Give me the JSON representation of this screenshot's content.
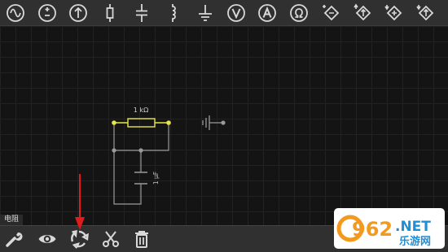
{
  "toolbar": {
    "items": [
      {
        "name": "ac-source-icon"
      },
      {
        "name": "dc-source-icon"
      },
      {
        "name": "current-source-icon"
      },
      {
        "name": "resistor-icon"
      },
      {
        "name": "capacitor-icon"
      },
      {
        "name": "inductor-icon"
      },
      {
        "name": "ground-icon"
      },
      {
        "name": "voltmeter-icon"
      },
      {
        "name": "ammeter-icon"
      },
      {
        "name": "ohmmeter-icon"
      },
      {
        "name": "controlled-source-1-icon"
      },
      {
        "name": "controlled-source-2-icon"
      },
      {
        "name": "controlled-source-3-icon"
      },
      {
        "name": "controlled-source-4-icon"
      }
    ]
  },
  "circuit": {
    "resistor_label": "1 kΩ",
    "capacitor_label": "1 μF"
  },
  "status": {
    "selected_component": "电阻"
  },
  "bottom_toolbar": {
    "items": [
      {
        "name": "settings-wrench-icon"
      },
      {
        "name": "view-eye-icon"
      },
      {
        "name": "rotate-icon"
      },
      {
        "name": "cut-scissors-icon"
      },
      {
        "name": "delete-trash-icon"
      }
    ]
  },
  "watermark": {
    "number": "962",
    "suffix": ".NET",
    "tagline": "乐游网"
  },
  "colors": {
    "toolbar_bg": "#303030",
    "icon": "#d8d8d8",
    "selected": "#e6e64a",
    "wire": "#9a9a9a",
    "arrow": "#e01b1b",
    "watermark_orange": "#f39a1e",
    "watermark_blue": "#1e8fd6"
  }
}
